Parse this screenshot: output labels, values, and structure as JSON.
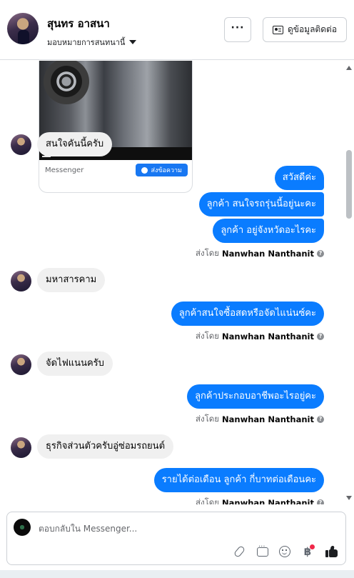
{
  "header": {
    "contact_name": "สุนทร อาสนา",
    "assign_label": "มอบหมายการสนทนานี้",
    "more_label": "···",
    "contact_info_label": "ดูข้อมูลติดต่อ"
  },
  "ad_card": {
    "source": "Messenger",
    "send_label": "ส่งข้อความ"
  },
  "messages": {
    "m1": "สนใจคันนี้ครับ",
    "m2": "สวัสดีค่ะ",
    "m3": "ลูกค้า สนใจรถรุ่นนี้อยู่นะคะ",
    "m4": "ลูกค้า อยู่จังหวัดอะไรคะ",
    "m5": "มหาสารคาม",
    "m6": "ลูกค้าสนใจซื้อสดหรือจัดไแน่นซ์คะ",
    "m7": "จัดไฟแนนครับ",
    "m8": "ลูกค้าประกอบอาชีพอะไรอยู่คะ",
    "m9": "ธุรกิจส่วนตัวครับอู่ซ่อมรถยนต์",
    "m10": "รายได้ต่อเดือน ลูกค้า กี่บาทต่อเดือนคะ"
  },
  "sent_by": {
    "prefix": "ส่งโดย",
    "agent": "Nanwhan Nanthanit"
  },
  "composer": {
    "placeholder": "ตอบกลับใน Messenger...",
    "baht_symbol": "฿"
  },
  "colors": {
    "outgoing": "#0a7cff",
    "incoming": "#f0f0f0",
    "notification": "#f02849"
  }
}
